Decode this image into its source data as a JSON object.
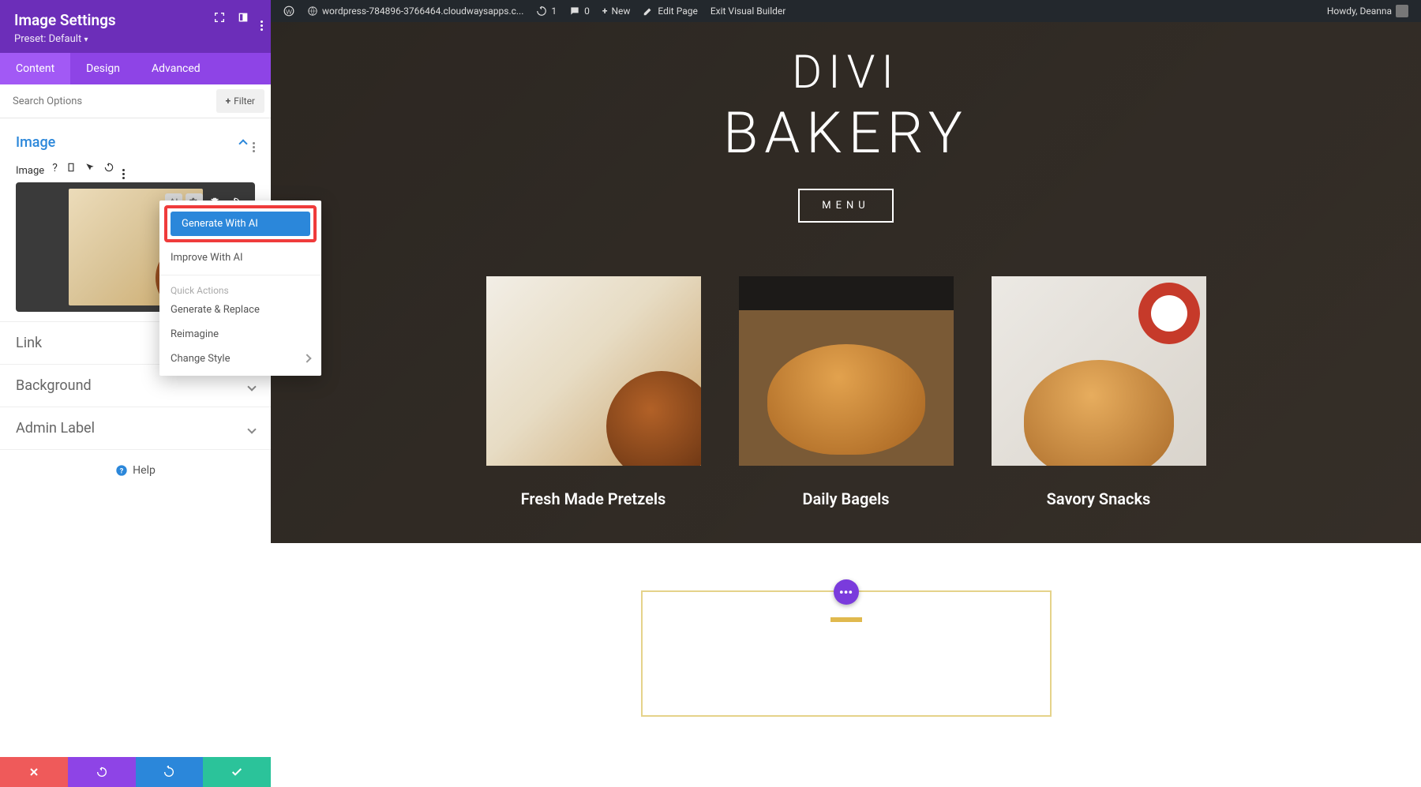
{
  "sidebar": {
    "title": "Image Settings",
    "preset": "Preset: Default",
    "tabs": {
      "content": "Content",
      "design": "Design",
      "advanced": "Advanced"
    },
    "search_placeholder": "Search Options",
    "filter_label": "Filter",
    "image_section_label": "Image",
    "image_field_label": "Image",
    "accordions": {
      "link": "Link",
      "background": "Background",
      "admin_label": "Admin Label"
    },
    "help_label": "Help"
  },
  "ai_menu": {
    "generate": "Generate With AI",
    "improve": "Improve With AI",
    "quick_actions_label": "Quick Actions",
    "generate_replace": "Generate & Replace",
    "reimagine": "Reimagine",
    "change_style": "Change Style"
  },
  "topbar": {
    "site_url": "wordpress-784896-3766464.cloudwaysapps.c...",
    "updates_count": "1",
    "comments_count": "0",
    "new_label": "New",
    "edit_page": "Edit Page",
    "exit_vb": "Exit Visual Builder",
    "howdy": "Howdy, Deanna"
  },
  "hero": {
    "logo_line1": "DIVI",
    "logo_line2": "BAKERY",
    "menu_btn": "MENU"
  },
  "products": [
    {
      "title": "Fresh Made Pretzels"
    },
    {
      "title": "Daily Bagels"
    },
    {
      "title": "Savory Snacks"
    }
  ],
  "fab_label": "•••"
}
